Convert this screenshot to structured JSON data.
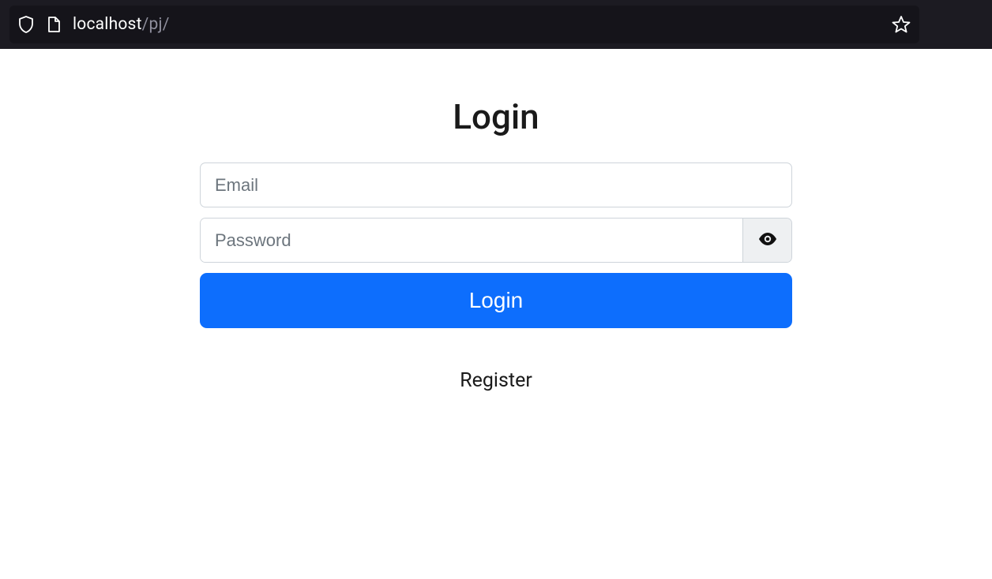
{
  "browser": {
    "url": {
      "host": "localhost",
      "path": "/pj/"
    }
  },
  "page": {
    "title": "Login",
    "form": {
      "email": {
        "placeholder": "Email",
        "value": ""
      },
      "password": {
        "placeholder": "Password",
        "value": ""
      },
      "submit_label": "Login"
    },
    "register_link_label": "Register"
  }
}
